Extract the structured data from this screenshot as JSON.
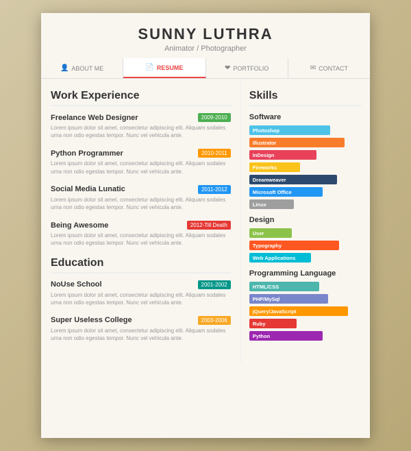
{
  "header": {
    "name": "SUNNY LUTHRA",
    "subtitle": "Animator / Photographer"
  },
  "nav": {
    "items": [
      {
        "label": "ABOUT ME",
        "icon": "👤",
        "active": false
      },
      {
        "label": "RESUME",
        "icon": "📄",
        "active": true
      },
      {
        "label": "PORTFOLIO",
        "icon": "❤",
        "active": false
      },
      {
        "label": "CONTACT",
        "icon": "✉",
        "active": false
      }
    ]
  },
  "work_experience": {
    "title": "Work Experience",
    "jobs": [
      {
        "title": "Freelance Web Designer",
        "date": "2009-2010",
        "date_color": "date-green",
        "desc": "Lorem ipsum dolor sit amet, consectetur adipiscing elit. Aliquam sodales urna non odio egestas tempor. Nunc vel vehicula ante."
      },
      {
        "title": "Python Programmer",
        "date": "2010-2011",
        "date_color": "date-orange",
        "desc": "Lorem ipsum dolor sit amet, consectetur adipiscing elit. Aliquam sodales urna non odio egestas tempor. Nunc vel vehicula ante."
      },
      {
        "title": "Social Media Lunatic",
        "date": "2011-2012",
        "date_color": "date-blue",
        "desc": "Lorem ipsum dolor sit amet, consectetur adipiscing elit. Aliquam sodales urna non odio egestas tempor. Nunc vel vehicula ante."
      },
      {
        "title": "Being Awesome",
        "date": "2012-Till Death",
        "date_color": "date-red",
        "desc": "Lorem ipsum dolor sit amet, consectetur adipiscing elit. Aliquam sodales urna non odio egestas tempor. Nunc vel vehicula ante."
      }
    ]
  },
  "education": {
    "title": "Education",
    "schools": [
      {
        "title": "NoUse School",
        "date": "2001-2002",
        "date_color": "date-teal",
        "desc": "Lorem ipsum dolor sit amet, consectetur adipiscing elit. Aliquam sodales urna non odio egestas tempor. Nunc vel vehicula ante."
      },
      {
        "title": "Super Useless College",
        "date": "2003-2006",
        "date_color": "date-yellow",
        "desc": "Lorem ipsum dolor sit amet, consectetur adipiscing elit. Aliquam sodales urna non odio egestas tempor. Nunc vel vehicula ante."
      }
    ]
  },
  "skills": {
    "title": "Skills",
    "software": {
      "label": "Software",
      "items": [
        {
          "name": "Photoshop",
          "class": "sk-photoshop"
        },
        {
          "name": "Illustrator",
          "class": "sk-illustrator"
        },
        {
          "name": "InDesign",
          "class": "sk-indesign"
        },
        {
          "name": "Fireworks",
          "class": "sk-fireworks"
        },
        {
          "name": "Dreamweaver",
          "class": "sk-dreamweaver"
        },
        {
          "name": "Microsoft Office",
          "class": "sk-msoffice"
        },
        {
          "name": "Linux",
          "class": "sk-linux"
        }
      ]
    },
    "design": {
      "label": "Design",
      "items": [
        {
          "name": "User",
          "class": "sk-user"
        },
        {
          "name": "Typography",
          "class": "sk-typography"
        },
        {
          "name": "Web Applications",
          "class": "sk-webapps"
        }
      ]
    },
    "programming": {
      "label": "Programming Language",
      "items": [
        {
          "name": "HTML/CSS",
          "class": "sk-htmlcss"
        },
        {
          "name": "PHP/MySql",
          "class": "sk-phpmysql"
        },
        {
          "name": "jQuery/JavaScript",
          "class": "sk-jquery"
        },
        {
          "name": "Ruby",
          "class": "sk-ruby"
        },
        {
          "name": "Python",
          "class": "sk-python"
        }
      ]
    }
  }
}
